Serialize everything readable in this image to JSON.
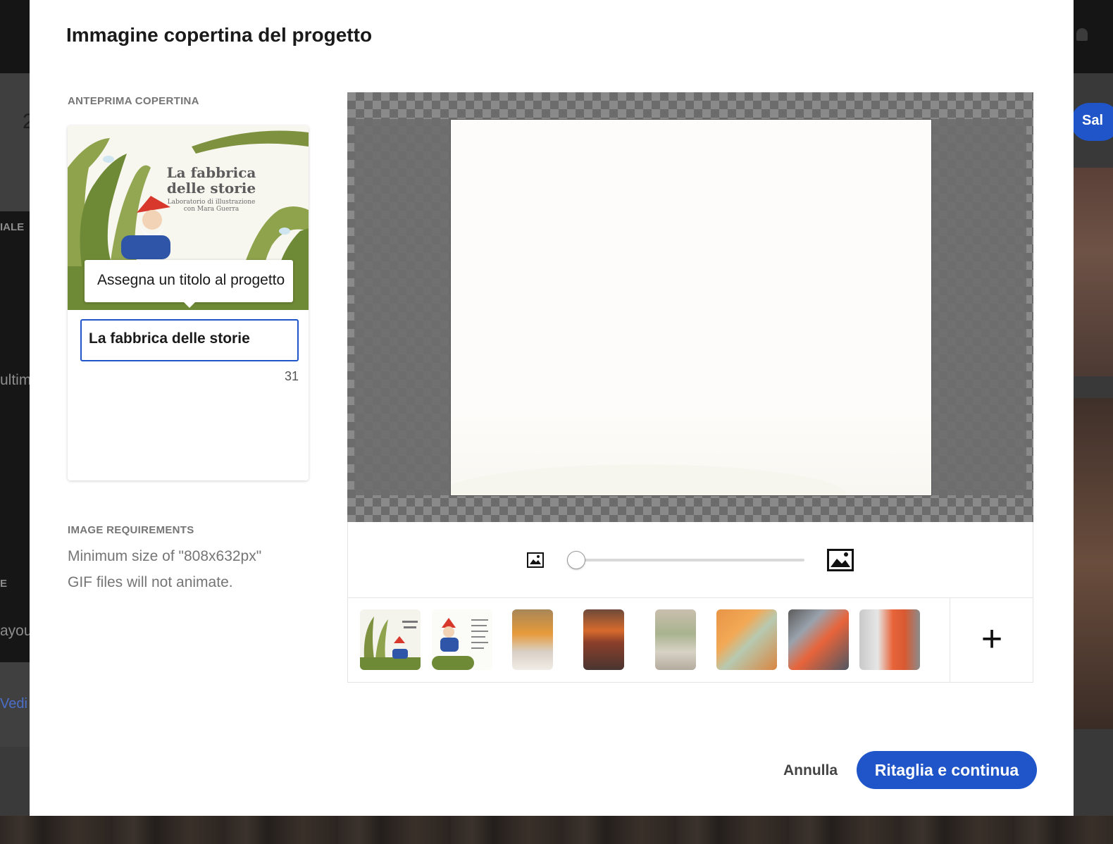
{
  "background": {
    "left_labels": [
      "IALE",
      "ultim",
      "E",
      "ayou"
    ],
    "link_text": "Vedi",
    "number_fragment": "2",
    "right_button_label": "Sal"
  },
  "modal": {
    "title": "Immagine copertina del progetto",
    "preview": {
      "section_label": "ANTEPRIMA COPERTINA",
      "cover_title": "La fabbrica delle storie",
      "cover_subtitle_line1": "Laboratorio di illustrazione",
      "cover_subtitle_line2": "con Mara Guerra",
      "tooltip": "Assegna un titolo al progetto",
      "title_input_value": "La fabbrica delle storie",
      "char_count": "31"
    },
    "requirements": {
      "section_label": "IMAGE REQUIREMENTS",
      "line1": "Minimum size of \"808x632px\"",
      "line2": "GIF files will not animate."
    },
    "editor": {
      "zoom_min_icon": "image-small-icon",
      "zoom_max_icon": "image-large-icon",
      "zoom_level": 0,
      "thumbnails": [
        {
          "name": "thumbnail-cover-beanstalk"
        },
        {
          "name": "thumbnail-gnome-text"
        },
        {
          "name": "thumbnail-photo-3"
        },
        {
          "name": "thumbnail-photo-4"
        },
        {
          "name": "thumbnail-photo-5"
        },
        {
          "name": "thumbnail-photo-6"
        },
        {
          "name": "thumbnail-photo-7"
        },
        {
          "name": "thumbnail-photo-8"
        }
      ],
      "add_label": "+"
    },
    "footer": {
      "cancel_label": "Annulla",
      "primary_label": "Ritaglia e continua"
    }
  },
  "colors": {
    "accent": "#1f55c8",
    "overlay": "#2b2b2b"
  }
}
